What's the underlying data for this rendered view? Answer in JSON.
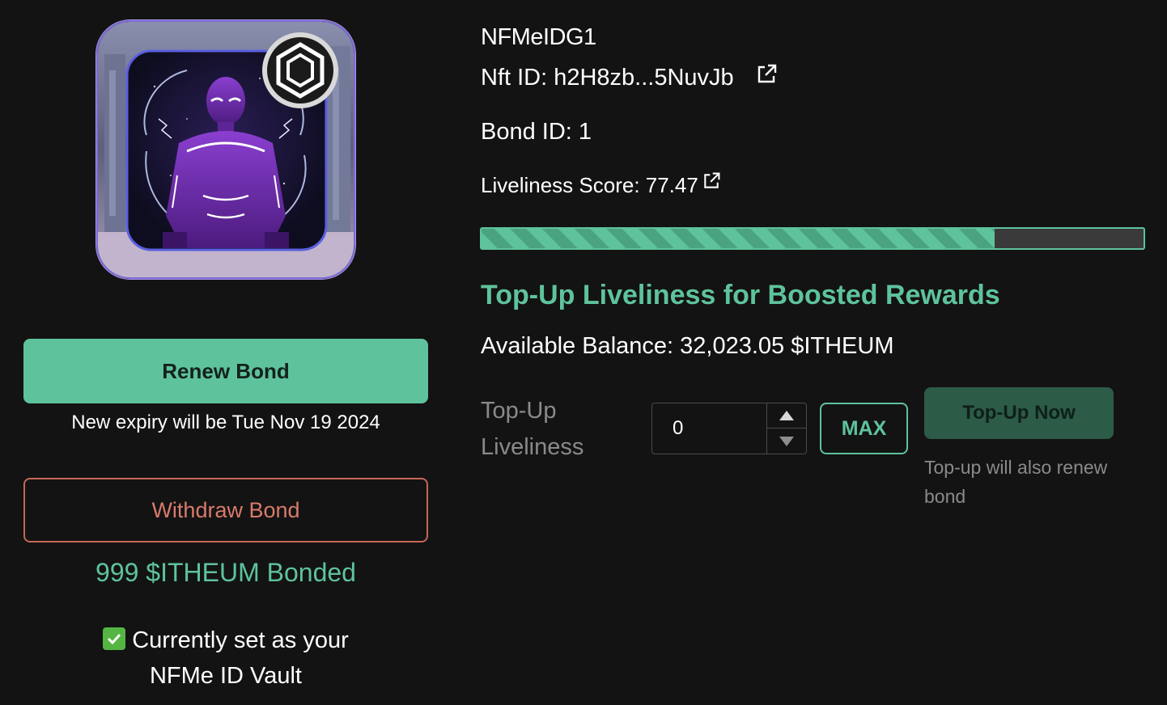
{
  "nft": {
    "title": "NFMeIDG1",
    "nft_id_label": "Nft ID: h2H8zb...5NuvJb",
    "bond_id_label": "Bond ID: 1",
    "liveliness_label": "Liveliness Score: 77.47",
    "liveliness_score": 77.47
  },
  "actions": {
    "renew_label": "Renew Bond",
    "expiry_text": "New expiry will be Tue Nov 19 2024",
    "withdraw_label": "Withdraw Bond",
    "bonded_text": "999 $ITHEUM Bonded",
    "vault_line1": "Currently set as your",
    "vault_line2": "NFMe ID Vault"
  },
  "topup": {
    "heading": "Top-Up Liveliness for Boosted Rewards",
    "balance_text": "Available Balance: 32,023.05 $ITHEUM",
    "field_label_line1": "Top-Up",
    "field_label_line2": "Liveliness",
    "input_value": "0",
    "max_label": "MAX",
    "submit_label": "Top-Up Now",
    "note": "Top-up will also renew bond"
  },
  "colors": {
    "accent": "#5ec39c",
    "danger": "#c66658",
    "background": "#131313",
    "muted": "#8a8a8a"
  },
  "icons": {
    "badge": "hexagon-badge-icon",
    "external_link": "external-link-icon",
    "check": "check-mark-icon",
    "stepper_up": "triangle-up-icon",
    "stepper_down": "triangle-down-icon"
  }
}
